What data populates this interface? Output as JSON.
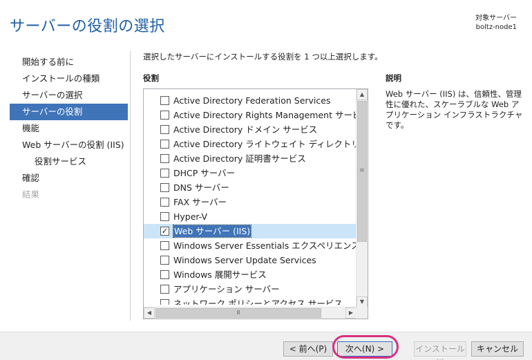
{
  "header": {
    "title": "サーバーの役割の選択",
    "target_label": "対象サーバー",
    "target_name": "boltz-node1"
  },
  "nav": {
    "items": [
      {
        "label": "開始する前に",
        "state": "normal"
      },
      {
        "label": "インストールの種類",
        "state": "normal"
      },
      {
        "label": "サーバーの選択",
        "state": "normal"
      },
      {
        "label": "サーバーの役割",
        "state": "active"
      },
      {
        "label": "機能",
        "state": "normal"
      },
      {
        "label": "Web サーバーの役割 (IIS)",
        "state": "normal"
      },
      {
        "label": "役割サービス",
        "state": "sub"
      },
      {
        "label": "確認",
        "state": "normal"
      },
      {
        "label": "結果",
        "state": "disabled"
      }
    ]
  },
  "main": {
    "instruction": "選択したサーバーにインストールする役割を 1 つ以上選択します。",
    "roles_heading": "役割",
    "roles": [
      {
        "label": "Active Directory Federation Services",
        "checked": false
      },
      {
        "label": "Active Directory Rights Management サービス",
        "checked": false
      },
      {
        "label": "Active Directory ドメイン サービス",
        "checked": false
      },
      {
        "label": "Active Directory ライトウェイト ディレクトリ サービス",
        "checked": false
      },
      {
        "label": "Active Directory 証明書サービス",
        "checked": false
      },
      {
        "label": "DHCP サーバー",
        "checked": false
      },
      {
        "label": "DNS サーバー",
        "checked": false
      },
      {
        "label": "FAX サーバー",
        "checked": false
      },
      {
        "label": "Hyper-V",
        "checked": false
      },
      {
        "label": "Web サーバー (IIS)",
        "checked": true,
        "selected": true
      },
      {
        "label": "Windows Server Essentials エクスペリエンス",
        "checked": false
      },
      {
        "label": "Windows Server Update Services",
        "checked": false
      },
      {
        "label": "Windows 展開サービス",
        "checked": false
      },
      {
        "label": "アプリケーション サーバー",
        "checked": false
      },
      {
        "label": "ネットワーク ポリシーとアクセス サービス",
        "checked": false
      }
    ],
    "description_heading": "説明",
    "description": "Web サーバー (IIS) は、信頼性、管理性に優れた、スケーラブルな Web アプリケーション インフラストラクチャです。"
  },
  "footer": {
    "prev_label": "< 前へ(P)",
    "next_label": "次へ(N) >",
    "install_label": "インストール(I)",
    "cancel_label": "キャンセル"
  },
  "colors": {
    "accent": "#3f74b9",
    "title": "#1f5fa5",
    "highlight_ring": "#d8307e"
  }
}
